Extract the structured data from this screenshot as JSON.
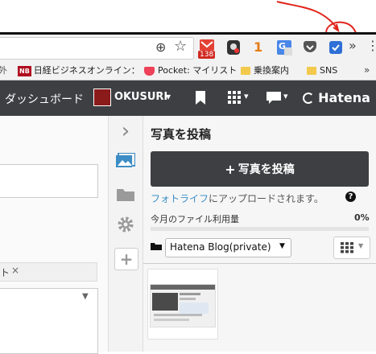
{
  "chrome": {
    "badges": {
      "gmail_count": "138",
      "orange_count": "1"
    },
    "menu_glyph": "⋮",
    "overflow_glyph": "»",
    "zoom_glyph": "⊕",
    "star_glyph": "☆"
  },
  "bookmarks": [
    {
      "label": "外"
    },
    {
      "label": "日経ビジネスオンライン：",
      "icon_text": "NB"
    },
    {
      "label": "Pocket: マイリスト"
    },
    {
      "label": "乗換案内"
    },
    {
      "label": "SNS"
    }
  ],
  "header": {
    "dashboard_label": "ダッシュボード",
    "blog_label": "OKUSURI",
    "dropdown_glyph": "▾",
    "hatena_label": "Hatena"
  },
  "left": {
    "tag_fragment": "ト",
    "close_glyph": "×"
  },
  "sidebar_icons": {
    "chevron_glyph": "›",
    "plus_glyph": "+"
  },
  "photo_panel": {
    "title": "写真を投稿",
    "post_button": "写真を投稿",
    "plus_glyph": "+",
    "fotolife_link": "フォトライフ",
    "upload_text": "にアップロードされます。",
    "help_glyph": "?",
    "usage_label": "今月のファイル利用量",
    "usage_percent": "0%",
    "usage_fraction": 0,
    "folder_select": "Hatena Blog(private)",
    "select_arrow": "▼"
  },
  "colors": {
    "header_bg": "#3d3f43",
    "button_bg": "#3d3f43",
    "link": "#3c8dc5",
    "annotation": "#e0241b"
  }
}
